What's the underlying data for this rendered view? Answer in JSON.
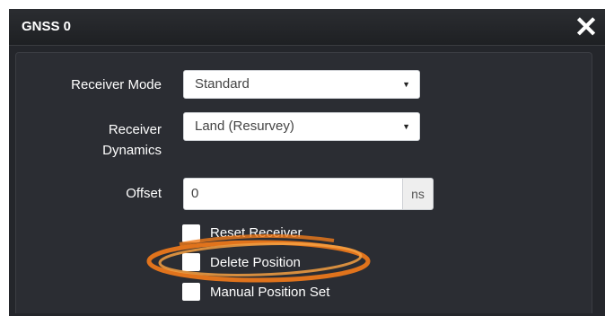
{
  "dialog": {
    "title": "GNSS 0",
    "close_glyph": "✕"
  },
  "form": {
    "receiver_mode": {
      "label": "Receiver Mode",
      "value": "Standard"
    },
    "receiver_dynamics": {
      "label_line1": "Receiver",
      "label_line2": "Dynamics",
      "value": "Land (Resurvey)"
    },
    "offset": {
      "label": "Offset",
      "value": "0",
      "unit": "ns"
    },
    "checkboxes": [
      {
        "label": "Reset Receiver",
        "checked": false
      },
      {
        "label": "Delete Position",
        "checked": false
      },
      {
        "label": "Manual Position Set",
        "checked": false
      }
    ]
  },
  "annotation": {
    "color": "#f07a1a",
    "highlighted_item": "Delete Position"
  },
  "icons": {
    "close": "close-icon",
    "dropdown": "chevron-down-icon"
  }
}
